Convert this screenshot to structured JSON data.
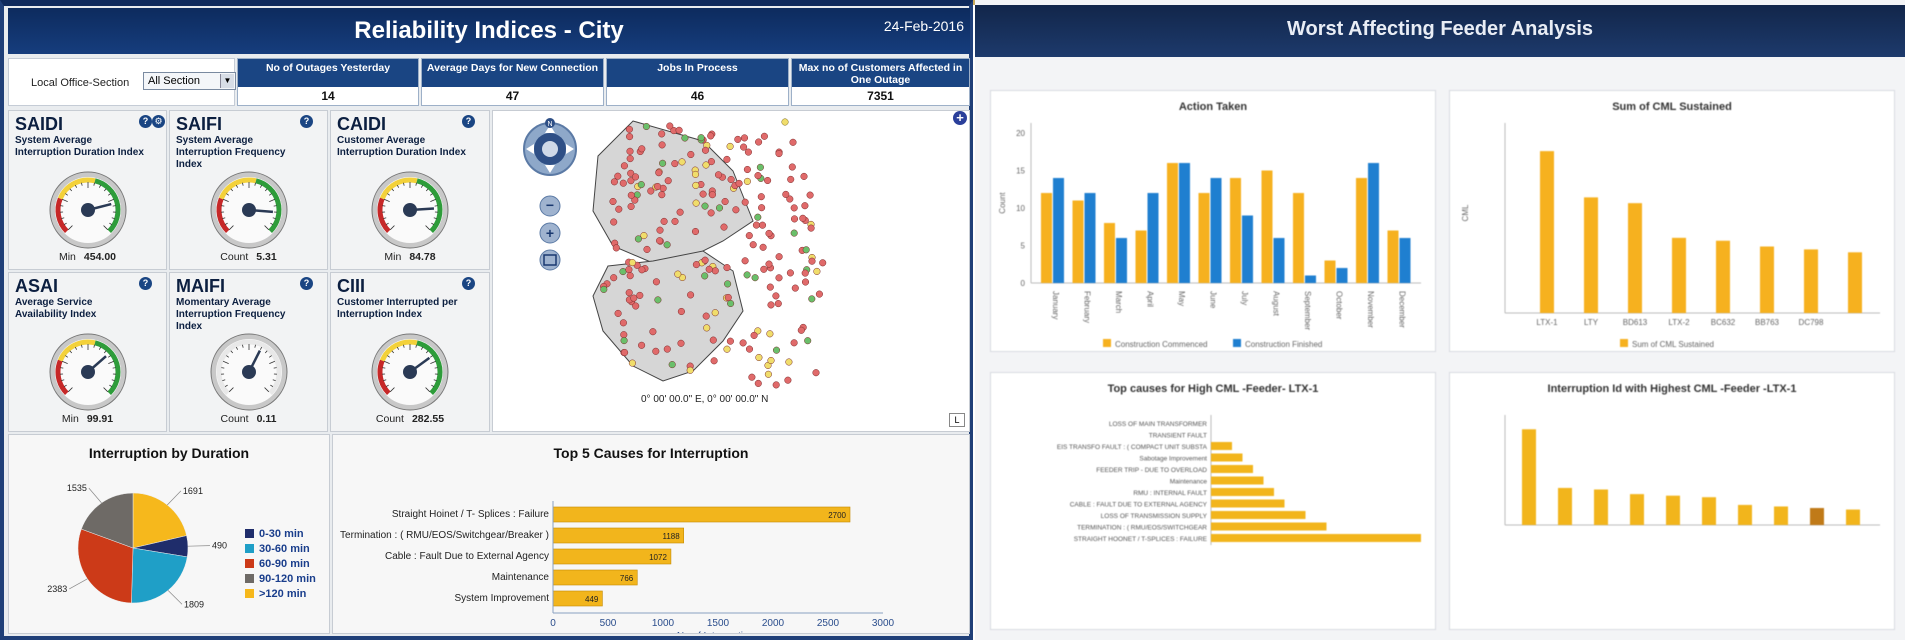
{
  "left_panel": {
    "title": "Reliability Indices  -  City",
    "date": "24-Feb-2016",
    "filter": {
      "label": "Local Office-Section",
      "selected": "All Section"
    },
    "kpis": [
      {
        "label": "No of Outages Yesterday",
        "value": "14"
      },
      {
        "label": "Average Days for New Connection",
        "value": "47"
      },
      {
        "label": "Jobs In Process",
        "value": "46"
      },
      {
        "label": "Max no of Customers Affected in One Outage",
        "value": "7351"
      }
    ],
    "indices": [
      {
        "abbr": "SAIDI",
        "desc": "System Average Interruption Duration Index",
        "stat_label": "Min",
        "stat_value": "454.00",
        "needle": 0.78
      },
      {
        "abbr": "SAIFI",
        "desc": "System Average Interruption Frequency Index",
        "stat_label": "Count",
        "stat_value": "5.31",
        "needle": 0.85
      },
      {
        "abbr": "CAIDI",
        "desc": "Customer Average Interruption Duration Index",
        "stat_label": "Min",
        "stat_value": "84.78",
        "needle": 0.82
      },
      {
        "abbr": "ASAI",
        "desc": "Average Service Availability Index",
        "stat_label": "Min",
        "stat_value": "99.91",
        "needle": 0.68
      },
      {
        "abbr": "MAIFI",
        "desc": "Momentary Average Interruption Frequency Index",
        "stat_label": "Count",
        "stat_value": "0.11",
        "needle": 0.6
      },
      {
        "abbr": "CIII",
        "desc": "Customer Interrupted per Interruption Index",
        "stat_label": "Count",
        "stat_value": "282.55",
        "needle": 0.7
      }
    ],
    "map": {
      "coords": "0° 00' 00.0\" E,    0° 00' 00.0\" N",
      "zoom_in": "+",
      "zoom_out": "−",
      "legend_btn": "L",
      "add_btn": "+"
    },
    "duration_chart": {
      "title": "Interruption by Duration",
      "chart_data": {
        "type": "pie",
        "slices": [
          {
            "label": "0-30 min",
            "value": 490,
            "color": "#1f2d6b"
          },
          {
            "label": "30-60 min",
            "value": 1809,
            "color": "#1f9fc7"
          },
          {
            "label": "60-90 min",
            "value": 2383,
            "color": "#cc3a18"
          },
          {
            "label": "90-120 min",
            "value": 1535,
            "color": "#6e6a66"
          },
          {
            "label": ">120 min",
            "value": 1691,
            "color": "#f6b81c"
          }
        ]
      }
    },
    "causes_chart": {
      "title": "Top 5 Causes for Interruption",
      "chart_data": {
        "type": "bar",
        "orientation": "horizontal",
        "categories": [
          "Straight Hoinet / T- Splices :  Failure",
          "Termination : ( RMU/EOS/Switchgear/Breaker )",
          "Cable :  Fault Due to External Agency",
          "Maintenance",
          "System Improvement"
        ],
        "values": [
          2700,
          1188,
          1072,
          766,
          449
        ],
        "xlabel": "No of Interruptions",
        "xlim": [
          0,
          3000
        ],
        "xticks": [
          "0",
          "500",
          "1000",
          "1500",
          "2000",
          "2500",
          "3000"
        ]
      }
    }
  },
  "right_panel": {
    "title": "Worst Affecting Feeder Analysis",
    "charts": [
      {
        "title": "Action Taken",
        "chart_data": {
          "type": "bar",
          "categories": [
            "January",
            "February",
            "March",
            "April",
            "May",
            "June",
            "July",
            "August",
            "September",
            "October",
            "November",
            "December"
          ],
          "series": [
            {
              "name": "Construction Commenced",
              "values": [
                12,
                11,
                8,
                7,
                16,
                12,
                14,
                15,
                12,
                3,
                14,
                7
              ]
            },
            {
              "name": "Construction Finished",
              "values": [
                14,
                12,
                6,
                12,
                16,
                14,
                9,
                6,
                1,
                2,
                16,
                6
              ]
            }
          ],
          "ylabel": "Count",
          "ylim": [
            0,
            20
          ]
        }
      },
      {
        "title": "Sum of CML Sustained",
        "chart_data": {
          "type": "bar",
          "categories": [
            "LTX-1",
            "LTY",
            "BD613",
            "LTX-2",
            "BC632",
            "BB763",
            "DC798"
          ],
          "values": [
            2800000,
            2000000,
            1900000,
            1300000,
            1250000,
            1150000,
            1100000,
            1050000
          ],
          "series_name": "Sum of CML Sustained",
          "ylabel": "CML"
        }
      },
      {
        "title": "Top causes for High CML -Feeder- LTX-1",
        "chart_data": {
          "type": "bar",
          "orientation": "horizontal",
          "categories": [
            "LOSS OF MAIN TRANSFORMER",
            "TRANSIENT FAULT",
            "EIS TRANSFO FAULT : ( COMPACT UNIT SUBSTA",
            "Sabotage Improvement",
            "FEEDER TRIP - DUE TO OVERLOAD",
            "Maintenance",
            "RMU : INTERNAL FAULT",
            "CABLE : FAULT DUE TO EXTERNAL AGENCY",
            "LOSS OF TRANSMISSION SUPPLY",
            "TERMINATION : ( RMU/EOS/SWITCHGEAR",
            "STRAIGHT HOONET / T-SPLICES : FAILURE"
          ],
          "values": [
            0,
            0,
            10,
            15,
            20,
            25,
            30,
            35,
            45,
            55,
            100
          ]
        }
      },
      {
        "title": "Interruption Id with Highest CML -Feeder -LTX-1",
        "chart_data": {
          "type": "bar",
          "values": [
            310000,
            120000,
            115000,
            100000,
            95000,
            90000,
            65000,
            60000,
            55000,
            50000
          ]
        }
      }
    ]
  }
}
